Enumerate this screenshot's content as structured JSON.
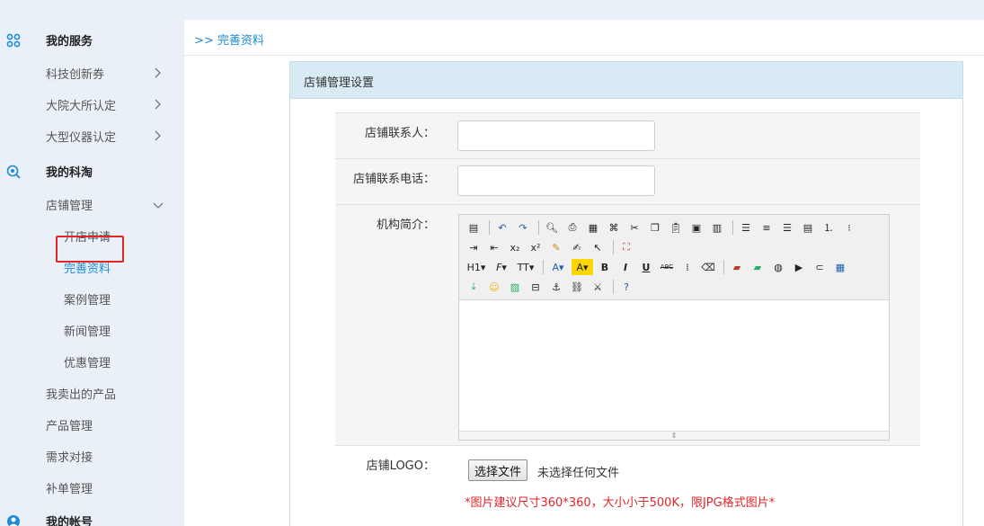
{
  "sidebar": {
    "sections": [
      {
        "title": "我的服务",
        "icon": "grid-icon"
      },
      {
        "title": "我的科淘",
        "icon": "magnifier-icon"
      },
      {
        "title": "我的帐号",
        "icon": "user-icon"
      }
    ],
    "service_items": [
      "科技创新券",
      "大院大所认定",
      "大型仪器认定"
    ],
    "store_group": "店铺管理",
    "store_sub_items": [
      "开店申请",
      "完善资料",
      "案例管理",
      "新闻管理",
      "优惠管理"
    ],
    "other_items": [
      "我卖出的产品",
      "产品管理",
      "需求对接",
      "补单管理"
    ]
  },
  "breadcrumb": ">> 完善资料",
  "panel": {
    "title": "店铺管理设置",
    "contact_label": "店铺联系人：",
    "contact_value": "",
    "phone_label": "店铺联系电话：",
    "phone_value": "",
    "intro_label": "机构简介：",
    "logo_label": "店铺LOGO：",
    "file_button": "选择文件",
    "file_status": "未选择任何文件",
    "hint": "*图片建议尺寸360*360，大小小于500K，限JPG格式图片*"
  },
  "editor_toolbar": {
    "heading": "H1",
    "font": "F",
    "size": "TT",
    "bold": "B",
    "italic": "I",
    "underline": "U",
    "strike": "ABC"
  },
  "colors": {
    "accent": "#1f8ad6",
    "highlight_box": "#e0262b",
    "hint": "#e0262b",
    "panel_head": "#d8eaf4"
  }
}
